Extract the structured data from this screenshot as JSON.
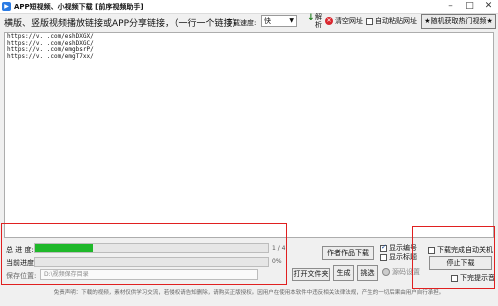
{
  "window": {
    "title": "APP短视频、小视频下载 [前序视频助手]",
    "minimize": "–",
    "maximize": "□",
    "close": "✕"
  },
  "toolbar": {
    "main_label": "横版、竖版视频播放链接或APP分享链接，（一行一个链接）",
    "speed_label": "下载速度:",
    "speed_value": "快",
    "parse_label": "解析",
    "clear_label": "清空网址",
    "auto_paste_label": "自动粘贴网址",
    "random_label": "★随机获取热门视频★"
  },
  "urls": [
    "https://v.       .com/eshDXGX/",
    "https://v.       .com/eshDXGC/",
    "https://v.       .com/emgbsrP/",
    "https://v.       .com/emgT7xx/"
  ],
  "progress": {
    "total_label": "总 进 度:",
    "total_fraction": 0.25,
    "total_count": "1 / 4",
    "current_label": "当前进度:",
    "current_fraction": 0,
    "current_pct": "0%",
    "save_label": "保存位置:",
    "save_path": "D:\\视频保存目录"
  },
  "buttons": {
    "author": "作者作品下载",
    "open_folder": "打开文件夹",
    "build": "生成",
    "pick": "挑选",
    "stop": "停止下载"
  },
  "options": {
    "show_number": "显示编号",
    "show_number_checked": true,
    "show_title": "显示标题",
    "show_title_checked": false,
    "source_label": "源码设置",
    "auto_shutdown": "下载完成自动关机",
    "auto_shutdown_checked": false,
    "done_alert": "下完提示音",
    "done_alert_checked": false
  },
  "footer": {
    "disclaimer": "免责声明：下载的视频，素材仅供学习交流，若侵权请告知删除，请购买正版授权。因用户在使用本软件中违反相关法律法规，产生的一切后果由用户自行承担。"
  },
  "colors": {
    "progress_green": "#1fb82a",
    "highlight_red": "#e02020",
    "accent_blue": "#2a7be4"
  }
}
